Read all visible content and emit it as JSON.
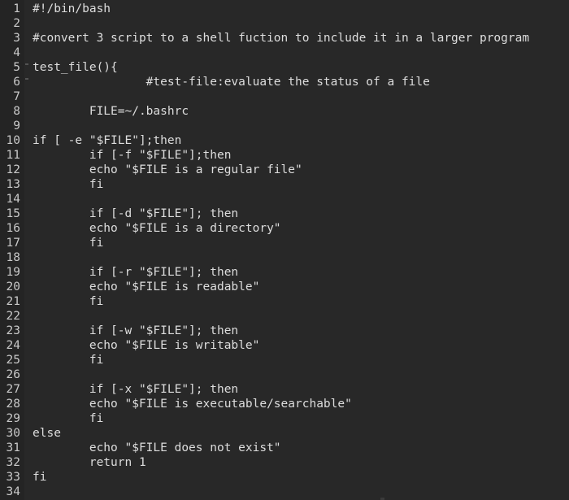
{
  "editor": {
    "background_color": "#282828",
    "gutter_color": "#242424",
    "text_color": "#dddddd",
    "gutter_text_color": "#c9c9c9",
    "total_lines": 34,
    "language": "bash"
  },
  "lines": [
    {
      "number": "1",
      "text": "#!/bin/bash"
    },
    {
      "number": "2",
      "text": ""
    },
    {
      "number": "3",
      "text": "#convert 3 script to a shell fuction to include it in a larger program"
    },
    {
      "number": "4",
      "text": ""
    },
    {
      "number": "5",
      "text": "test_file(){"
    },
    {
      "number": "6",
      "text": "                #test-file:evaluate the status of a file"
    },
    {
      "number": "7",
      "text": ""
    },
    {
      "number": "8",
      "text": "        FILE=~/.bashrc"
    },
    {
      "number": "9",
      "text": ""
    },
    {
      "number": "10",
      "text": "if [ -e \"$FILE\"];then"
    },
    {
      "number": "11",
      "text": "        if [-f \"$FILE\"];then"
    },
    {
      "number": "12",
      "text": "        echo \"$FILE is a regular file\""
    },
    {
      "number": "13",
      "text": "        fi"
    },
    {
      "number": "14",
      "text": ""
    },
    {
      "number": "15",
      "text": "        if [-d \"$FILE\"]; then"
    },
    {
      "number": "16",
      "text": "        echo \"$FILE is a directory\""
    },
    {
      "number": "17",
      "text": "        fi"
    },
    {
      "number": "18",
      "text": ""
    },
    {
      "number": "19",
      "text": "        if [-r \"$FILE\"]; then"
    },
    {
      "number": "20",
      "text": "        echo \"$FILE is readable\""
    },
    {
      "number": "21",
      "text": "        fi"
    },
    {
      "number": "22",
      "text": ""
    },
    {
      "number": "23",
      "text": "        if [-w \"$FILE\"]; then"
    },
    {
      "number": "24",
      "text": "        echo \"$FILE is writable\""
    },
    {
      "number": "25",
      "text": "        fi"
    },
    {
      "number": "26",
      "text": ""
    },
    {
      "number": "27",
      "text": "        if [-x \"$FILE\"]; then"
    },
    {
      "number": "28",
      "text": "        echo \"$FILE is executable/searchable\""
    },
    {
      "number": "29",
      "text": "        fi"
    },
    {
      "number": "30",
      "text": "else"
    },
    {
      "number": "31",
      "text": "        echo \"$FILE does not exist\""
    },
    {
      "number": "32",
      "text": "        return 1"
    },
    {
      "number": "33",
      "text": "fi"
    },
    {
      "number": "34",
      "text": ""
    }
  ]
}
